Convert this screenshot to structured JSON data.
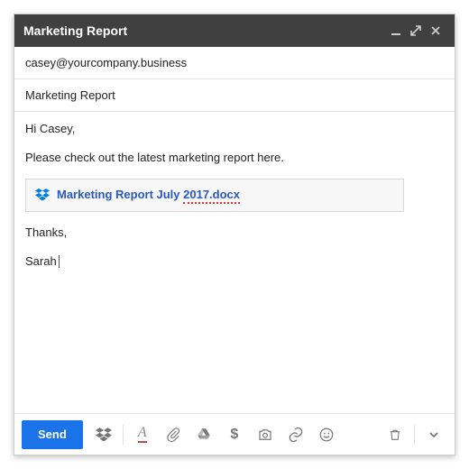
{
  "window": {
    "title": "Marketing Report"
  },
  "to": "casey@yourcompany.business",
  "subject": "Marketing Report",
  "body": {
    "greeting": "Hi Casey,",
    "line1": "Please check out the latest marketing report here.",
    "attachment_name_prefix": "Marketing Report July ",
    "attachment_name_flagged": "2017.docx",
    "thanks": "Thanks,",
    "signature": "Sarah"
  },
  "toolbar": {
    "send": "Send",
    "format_label": "A",
    "money_label": "$"
  }
}
